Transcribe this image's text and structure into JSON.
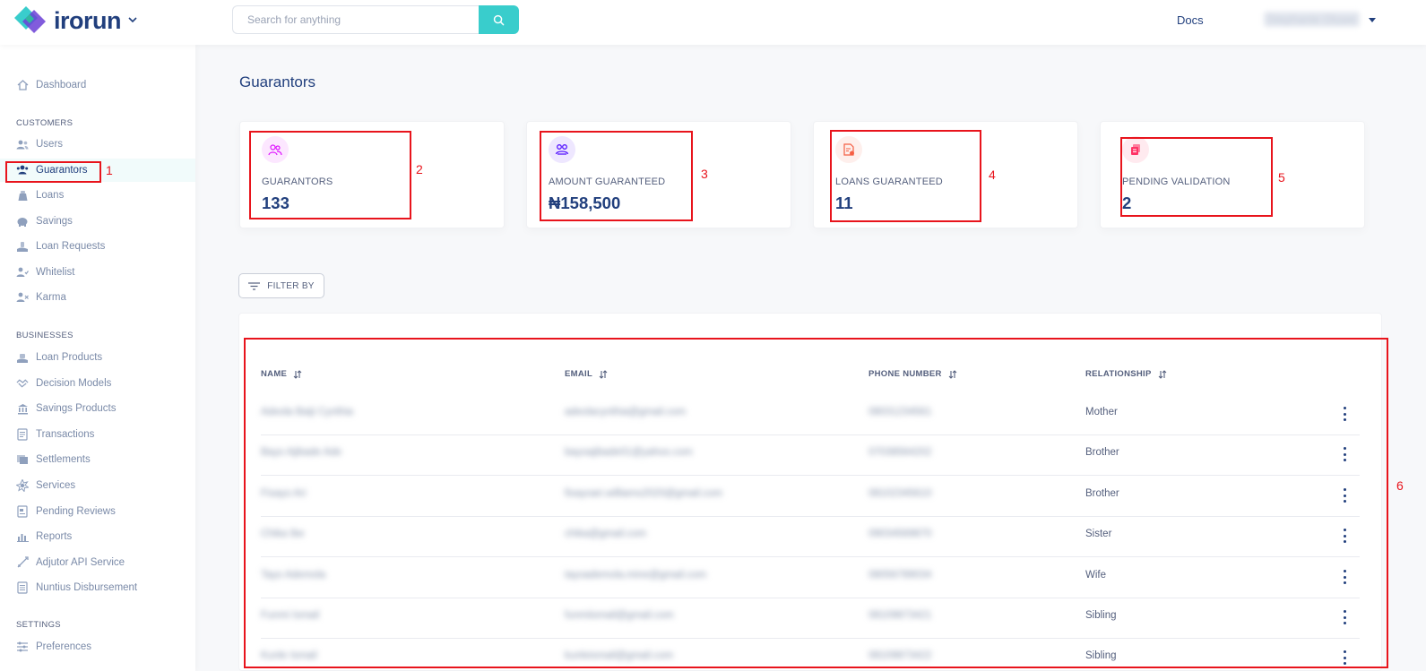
{
  "header": {
    "brand": "irorun",
    "search_placeholder": "Search for anything",
    "docs_label": "Docs",
    "user_name": "Stephanie Oluwe"
  },
  "sidebar": {
    "dashboard": "Dashboard",
    "customers_title": "CUSTOMERS",
    "customers": [
      {
        "label": "Users",
        "icon": "users-icon"
      },
      {
        "label": "Guarantors",
        "icon": "guarantors-icon",
        "active": true
      },
      {
        "label": "Loans",
        "icon": "loans-icon"
      },
      {
        "label": "Savings",
        "icon": "savings-icon"
      },
      {
        "label": "Loan Requests",
        "icon": "loan-requests-icon"
      },
      {
        "label": "Whitelist",
        "icon": "whitelist-icon"
      },
      {
        "label": "Karma",
        "icon": "karma-icon"
      }
    ],
    "businesses_title": "BUSINESSES",
    "businesses": [
      {
        "label": "Loan Products",
        "icon": "loan-products-icon"
      },
      {
        "label": "Decision Models",
        "icon": "decision-models-icon"
      },
      {
        "label": "Savings Products",
        "icon": "savings-products-icon"
      },
      {
        "label": "Transactions",
        "icon": "transactions-icon"
      },
      {
        "label": "Settlements",
        "icon": "settlements-icon"
      },
      {
        "label": "Services",
        "icon": "services-icon"
      },
      {
        "label": "Pending Reviews",
        "icon": "pending-reviews-icon"
      },
      {
        "label": "Reports",
        "icon": "reports-icon"
      },
      {
        "label": "Adjutor API Service",
        "icon": "api-service-icon"
      },
      {
        "label": "Nuntius Disbursement",
        "icon": "disbursement-icon"
      }
    ],
    "settings_title": "SETTINGS",
    "settings": [
      {
        "label": "Preferences",
        "icon": "preferences-icon"
      }
    ]
  },
  "page": {
    "title": "Guarantors",
    "filter_label": "FILTER BY"
  },
  "stats": [
    {
      "label": "GUARANTORS",
      "value": "133",
      "color": "#df18ff"
    },
    {
      "label": "AMOUNT GUARANTEED",
      "value": "₦158,500",
      "color": "#5718ff"
    },
    {
      "label": "LOANS GUARANTEED",
      "value": "11",
      "color": "#f55f44"
    },
    {
      "label": "PENDING VALIDATION",
      "value": "2",
      "color": "#ff3366"
    }
  ],
  "table": {
    "columns": [
      "NAME",
      "EMAIL",
      "PHONE NUMBER",
      "RELATIONSHIP"
    ],
    "rows": [
      {
        "name": "Adeola Baiji Cynthia",
        "email": "adeolacynthia@gmail.com",
        "phone": "08031234561",
        "relationship": "Mother"
      },
      {
        "name": "Bayo Ajibade Ade",
        "email": "bayoajibade01@yahoo.com",
        "phone": "07038564202",
        "relationship": "Brother"
      },
      {
        "name": "Fisayo Ari",
        "email": "fisayoari.williams2020@gmail.com",
        "phone": "08102345610",
        "relationship": "Brother"
      },
      {
        "name": "Chika Ibe",
        "email": "chika@gmail.com",
        "phone": "09034569870",
        "relationship": "Sister"
      },
      {
        "name": "Tayo Ademola",
        "email": "tayoademola.mine@gmail.com",
        "phone": "08056789034",
        "relationship": "Wife"
      },
      {
        "name": "Funmi Ismail",
        "email": "funmiismail@gmail.com",
        "phone": "08109873421",
        "relationship": "Sibling"
      },
      {
        "name": "Kunle Ismail",
        "email": "kunleismail@gmail.com",
        "phone": "08109873422",
        "relationship": "Sibling"
      }
    ]
  },
  "annotations": [
    "1",
    "2",
    "3",
    "4",
    "5",
    "6"
  ],
  "colors": {
    "accent": "#39cdcc",
    "primary": "#213f7d",
    "annotation": "#e8141c"
  }
}
